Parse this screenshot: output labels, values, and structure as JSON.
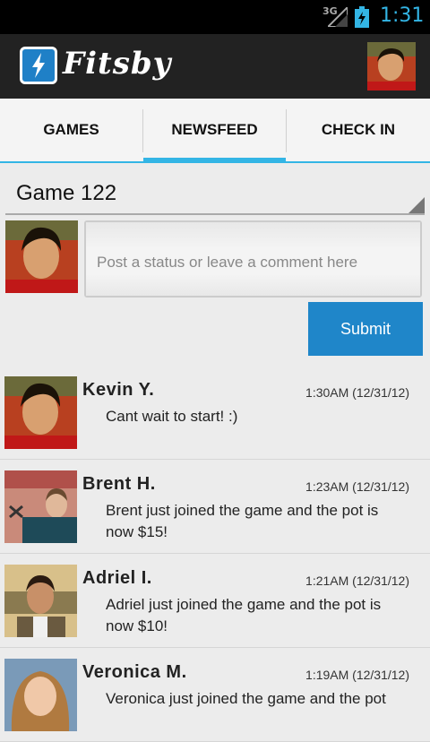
{
  "status_bar": {
    "network": "3G",
    "time": "1:31"
  },
  "app": {
    "title": "Fitsby",
    "colors": {
      "accent": "#33b5e5",
      "button": "#1f86c9",
      "actionbar": "#222222"
    }
  },
  "tabs": [
    {
      "label": "GAMES",
      "selected": false
    },
    {
      "label": "NEWSFEED",
      "selected": true
    },
    {
      "label": "CHECK IN",
      "selected": false
    }
  ],
  "game_selector": {
    "value": "Game 122"
  },
  "composer": {
    "placeholder": "Post a status or leave a comment here",
    "submit_label": "Submit"
  },
  "feed": [
    {
      "name": "Kevin  Y.",
      "time": "1:30AM (12/31/12)",
      "message": "Cant wait to start! :)"
    },
    {
      "name": "Brent  H.",
      "time": "1:23AM (12/31/12)",
      "message": "Brent just joined the game and the pot is now $15!"
    },
    {
      "name": "Adriel  I.",
      "time": "1:21AM (12/31/12)",
      "message": "Adriel just joined the game and the pot is now $10!"
    },
    {
      "name": "Veronica  M.",
      "time": "1:19AM (12/31/12)",
      "message": "Veronica just joined the game and the pot"
    }
  ]
}
